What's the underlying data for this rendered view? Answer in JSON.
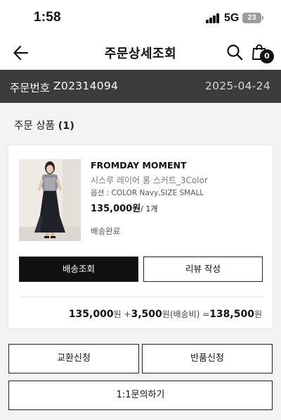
{
  "status_bar": {
    "time": "1:58",
    "network": "5G",
    "battery": "23"
  },
  "header": {
    "title": "주문상세조회",
    "icons": {
      "back": "arrow-left-icon",
      "search": "search-icon",
      "cart": "shopping-bag-icon"
    },
    "cart_count": "0"
  },
  "order": {
    "label": "주문번호",
    "number": "Z02314094",
    "date": "2025-04-24"
  },
  "section": {
    "title": "주문 상품",
    "count": "(1)"
  },
  "product": {
    "brand": "FROMDAY MOMENT",
    "name": "시스루 레이어 롱 스커트_3Color",
    "option": "옵션 : COLOR Navy,SIZE SMALL",
    "price": "135,000원",
    "quantity": "/ 1개",
    "status": "배송완료",
    "track_button": "배송조회",
    "review_button": "리뷰 작성"
  },
  "totals": {
    "product_total": "135,000",
    "won1": "원 +",
    "shipping": "3,500",
    "shipping_label": "원(배송비) =",
    "grand_total": "138,500",
    "won2": "원"
  },
  "actions": {
    "exchange": "교환신청",
    "return": "반품신청",
    "inquiry": "1:1문의하기"
  },
  "colors": {
    "order_bar_bg": "#3c3c3c",
    "primary_button": "#111111",
    "page_bg": "#f3f3f3"
  }
}
